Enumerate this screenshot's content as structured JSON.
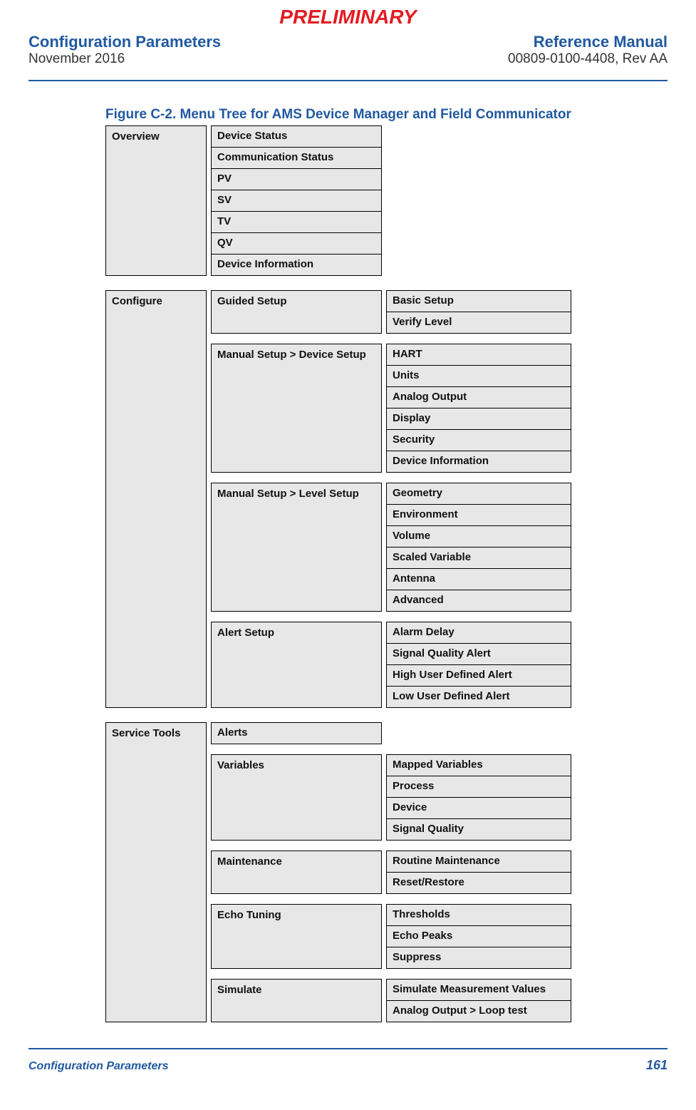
{
  "watermark": "PRELIMINARY",
  "header": {
    "left_title": "Configuration Parameters",
    "left_date": "November 2016",
    "right_title": "Reference Manual",
    "right_docnum": "00809-0100-4408, Rev AA"
  },
  "figure_caption": "Figure C-2. Menu Tree for AMS Device Manager and Field Communicator",
  "tree": {
    "overview": {
      "label": "Overview",
      "children": [
        "Device Status",
        "Communication Status",
        "PV",
        "SV",
        "TV",
        "QV",
        "Device Information"
      ]
    },
    "configure": {
      "label": "Configure",
      "groups": [
        {
          "label": "Guided Setup",
          "children": [
            "Basic Setup",
            "Verify Level"
          ]
        },
        {
          "label": "Manual Setup > Device Setup",
          "children": [
            "HART",
            "Units",
            "Analog Output",
            "Display",
            "Security",
            "Device Information"
          ]
        },
        {
          "label": "Manual Setup > Level Setup",
          "children": [
            "Geometry",
            "Environment",
            "Volume",
            "Scaled Variable",
            "Antenna",
            "Advanced"
          ]
        },
        {
          "label": "Alert Setup",
          "children": [
            "Alarm Delay",
            "Signal Quality Alert",
            "High User Defined Alert",
            "Low User Defined Alert"
          ]
        }
      ]
    },
    "service": {
      "label": "Service Tools",
      "groups": [
        {
          "label": "Alerts",
          "children": []
        },
        {
          "label": "Variables",
          "children": [
            "Mapped Variables",
            "Process",
            "Device",
            "Signal Quality"
          ]
        },
        {
          "label": "Maintenance",
          "children": [
            "Routine Maintenance",
            "Reset/Restore"
          ]
        },
        {
          "label": "Echo Tuning",
          "children": [
            "Thresholds",
            "Echo Peaks",
            "Suppress"
          ]
        },
        {
          "label": "Simulate",
          "children": [
            "Simulate Measurement Values",
            "Analog Output > Loop test"
          ]
        }
      ]
    }
  },
  "footer": {
    "left": "Configuration Parameters",
    "page": "161"
  }
}
